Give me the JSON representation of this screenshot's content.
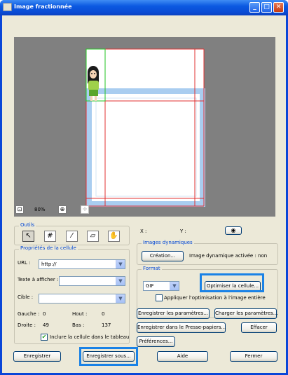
{
  "window": {
    "title": "Image fractionnée",
    "controls": {
      "minimize": "_",
      "maximize": "□",
      "close": "✕"
    }
  },
  "zoom": {
    "level": "80%"
  },
  "tools": {
    "label": "Outils",
    "items": [
      "pointer-icon",
      "grid-icon",
      "knife-icon",
      "eraser-icon",
      "hand-icon"
    ]
  },
  "coords": {
    "x_label": "X :",
    "y_label": "Y :"
  },
  "properties": {
    "label": "Propriétés de la cellule",
    "url_label": "URL :",
    "url_value": "http://",
    "text_label": "Texte à afficher :",
    "text_value": "",
    "target_label": "Cible :",
    "target_value": "",
    "left_label": "Gauche :",
    "left_value": "0",
    "top_label": "Hout :",
    "top_value": "0",
    "right_label": "Droite :",
    "right_value": "49",
    "bottom_label": "Bas :",
    "bottom_value": "137",
    "include_label": "Inclure la cellule dans le tableau",
    "include_checked": true
  },
  "dynamic": {
    "label": "Images dynamiques",
    "create_button": "Création...",
    "status": "Image dynamique activée :  non"
  },
  "format": {
    "label": "Format",
    "value": "GIF",
    "optimize_button": "Optimiser la cellule...",
    "apply_all_label": "Appliquer l'optimisation à l'image entière"
  },
  "actions": {
    "save_params": "Enregistrer les paramètres...",
    "load_params": "Charger les paramètres...",
    "save_clipboard": "Enregistrer dans le Presse-papiers...",
    "clear": "Effacer",
    "preferences": "Préférences..."
  },
  "footer": {
    "save": "Enregistrer",
    "save_as": "Enregistrer sous...",
    "help": "Aide",
    "close": "Fermer"
  },
  "colors": {
    "highlight": "#1a82e6",
    "slice_line": "#e03030",
    "cell_selected": "#22c322",
    "frame_blue": "#a9cdf0",
    "canvas_bg": "#808080"
  }
}
